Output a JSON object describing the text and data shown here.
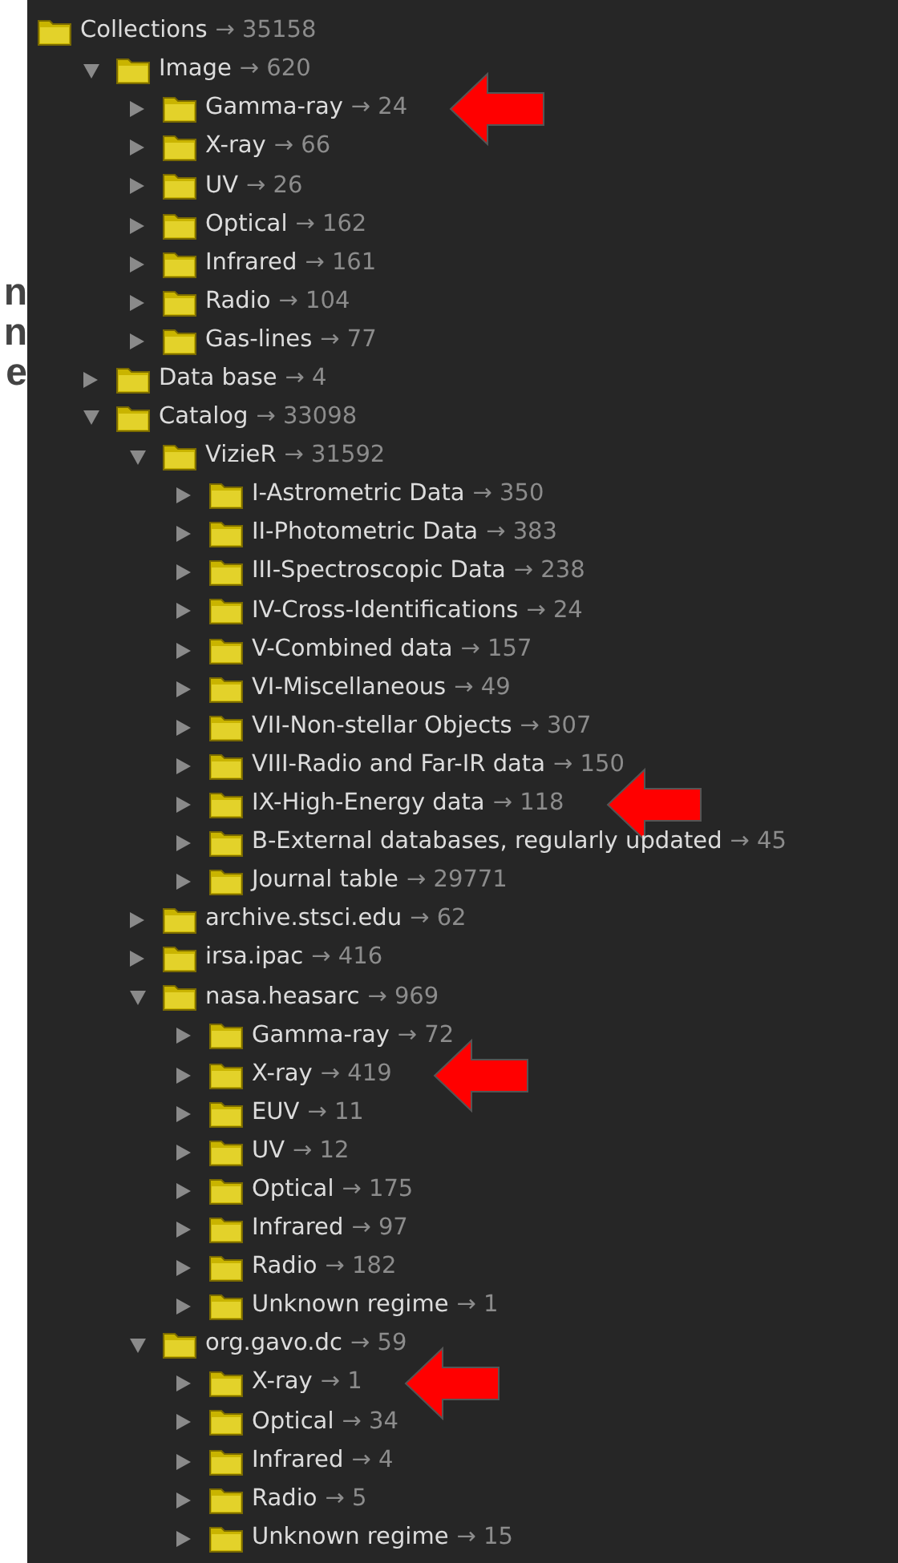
{
  "side_text": [
    "n",
    "n",
    "e"
  ],
  "tree": [
    {
      "label": "Collections",
      "count": "→ 35158",
      "children": [
        {
          "label": "Image",
          "count": "→ 620",
          "expanded": true,
          "children": [
            {
              "label": "Gamma-ray",
              "count": "→ 24",
              "expanded": false,
              "marked": true
            },
            {
              "label": "X-ray",
              "count": "→ 66",
              "expanded": false
            },
            {
              "label": "UV",
              "count": "→ 26",
              "expanded": false
            },
            {
              "label": "Optical",
              "count": "→ 162",
              "expanded": false
            },
            {
              "label": "Infrared",
              "count": "→ 161",
              "expanded": false
            },
            {
              "label": "Radio",
              "count": "→ 104",
              "expanded": false
            },
            {
              "label": "Gas-lines",
              "count": "→ 77",
              "expanded": false
            }
          ]
        },
        {
          "label": "Data base",
          "count": "→ 4",
          "expanded": false
        },
        {
          "label": "Catalog",
          "count": "→ 33098",
          "expanded": true,
          "children": [
            {
              "label": "VizieR",
              "count": "→ 31592",
              "expanded": true,
              "children": [
                {
                  "label": "I-Astrometric Data",
                  "count": "→ 350",
                  "expanded": false
                },
                {
                  "label": "II-Photometric Data",
                  "count": "→ 383",
                  "expanded": false
                },
                {
                  "label": "III-Spectroscopic Data",
                  "count": "→ 238",
                  "expanded": false
                },
                {
                  "label": "IV-Cross-Identifications",
                  "count": "→ 24",
                  "expanded": false
                },
                {
                  "label": "V-Combined data",
                  "count": "→ 157",
                  "expanded": false
                },
                {
                  "label": "VI-Miscellaneous",
                  "count": "→ 49",
                  "expanded": false
                },
                {
                  "label": "VII-Non-stellar Objects",
                  "count": "→ 307",
                  "expanded": false
                },
                {
                  "label": "VIII-Radio and Far-IR data",
                  "count": "→ 150",
                  "expanded": false
                },
                {
                  "label": "IX-High-Energy data",
                  "count": "→ 118",
                  "expanded": false,
                  "marked": true
                },
                {
                  "label": "B-External databases, regularly updated",
                  "count": "→ 45",
                  "expanded": false
                },
                {
                  "label": "Journal table",
                  "count": "→ 29771",
                  "expanded": false
                }
              ]
            },
            {
              "label": "archive.stsci.edu",
              "count": "→ 62",
              "expanded": false
            },
            {
              "label": "irsa.ipac",
              "count": "→ 416",
              "expanded": false
            },
            {
              "label": "nasa.heasarc",
              "count": "→ 969",
              "expanded": true,
              "children": [
                {
                  "label": "Gamma-ray",
                  "count": "→ 72",
                  "expanded": false
                },
                {
                  "label": "X-ray",
                  "count": "→ 419",
                  "expanded": false,
                  "marked": true
                },
                {
                  "label": "EUV",
                  "count": "→ 11",
                  "expanded": false
                },
                {
                  "label": "UV",
                  "count": "→ 12",
                  "expanded": false
                },
                {
                  "label": "Optical",
                  "count": "→ 175",
                  "expanded": false
                },
                {
                  "label": "Infrared",
                  "count": "→ 97",
                  "expanded": false
                },
                {
                  "label": "Radio",
                  "count": "→ 182",
                  "expanded": false
                },
                {
                  "label": "Unknown regime",
                  "count": "→ 1",
                  "expanded": false
                }
              ]
            },
            {
              "label": "org.gavo.dc",
              "count": "→ 59",
              "expanded": true,
              "children": [
                {
                  "label": "X-ray",
                  "count": "→ 1",
                  "expanded": false,
                  "marked": true
                },
                {
                  "label": "Optical",
                  "count": "→ 34",
                  "expanded": false
                },
                {
                  "label": "Infrared",
                  "count": "→ 4",
                  "expanded": false
                },
                {
                  "label": "Radio",
                  "count": "→ 5",
                  "expanded": false
                },
                {
                  "label": "Unknown regime",
                  "count": "→ 15",
                  "expanded": false
                }
              ]
            }
          ]
        }
      ]
    }
  ]
}
